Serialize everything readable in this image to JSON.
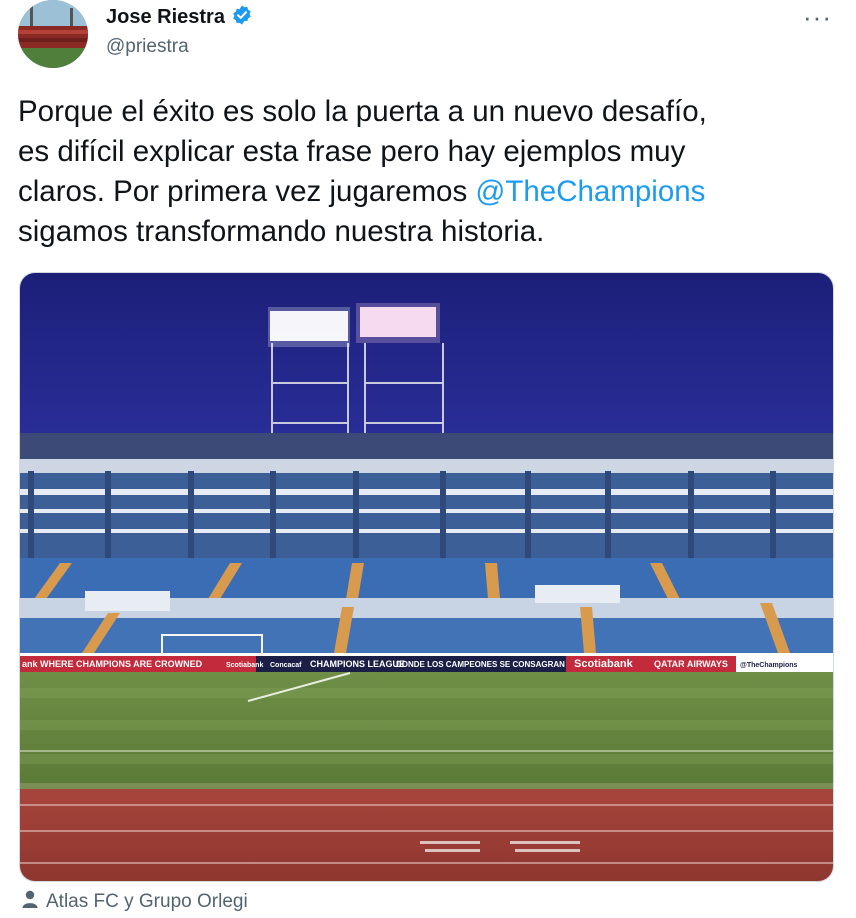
{
  "author": {
    "name": "Jose Riestra",
    "handle": "@priestra"
  },
  "tweet": {
    "text_line1": "Porque el éxito es solo la puerta a un nuevo desafío,",
    "text_line2": "es difícil explicar esta frase pero hay ejemplos muy",
    "text_line3_before": "claros. Por primera vez jugaremos ",
    "mention": "@TheChampions",
    "text_line4": "sigamos transformando nuestra historia."
  },
  "media": {
    "banner_left": "ank  WHERE CHAMPIONS ARE CROWNED",
    "banner_scotiabank_small": "Scotiabank",
    "banner_concacaf": "Concacaf",
    "banner_champions_league": "CHAMPIONS LEAGUE",
    "banner_spanish": "DONDE LOS CAMPEONES SE CONSAGRAN",
    "banner_scotiabank": "Scotiabank",
    "banner_qatar": "QATAR AIRWAYS",
    "banner_handle": "@TheChampions"
  },
  "tagged": "Atlas FC y Grupo Orlegi",
  "icons": [
    "avatar",
    "verified-badge-icon",
    "more-icon",
    "person-icon"
  ],
  "colors": {
    "mention": "#1d9bf0",
    "verified": "#1d9bf0",
    "secondary": "#536471"
  }
}
